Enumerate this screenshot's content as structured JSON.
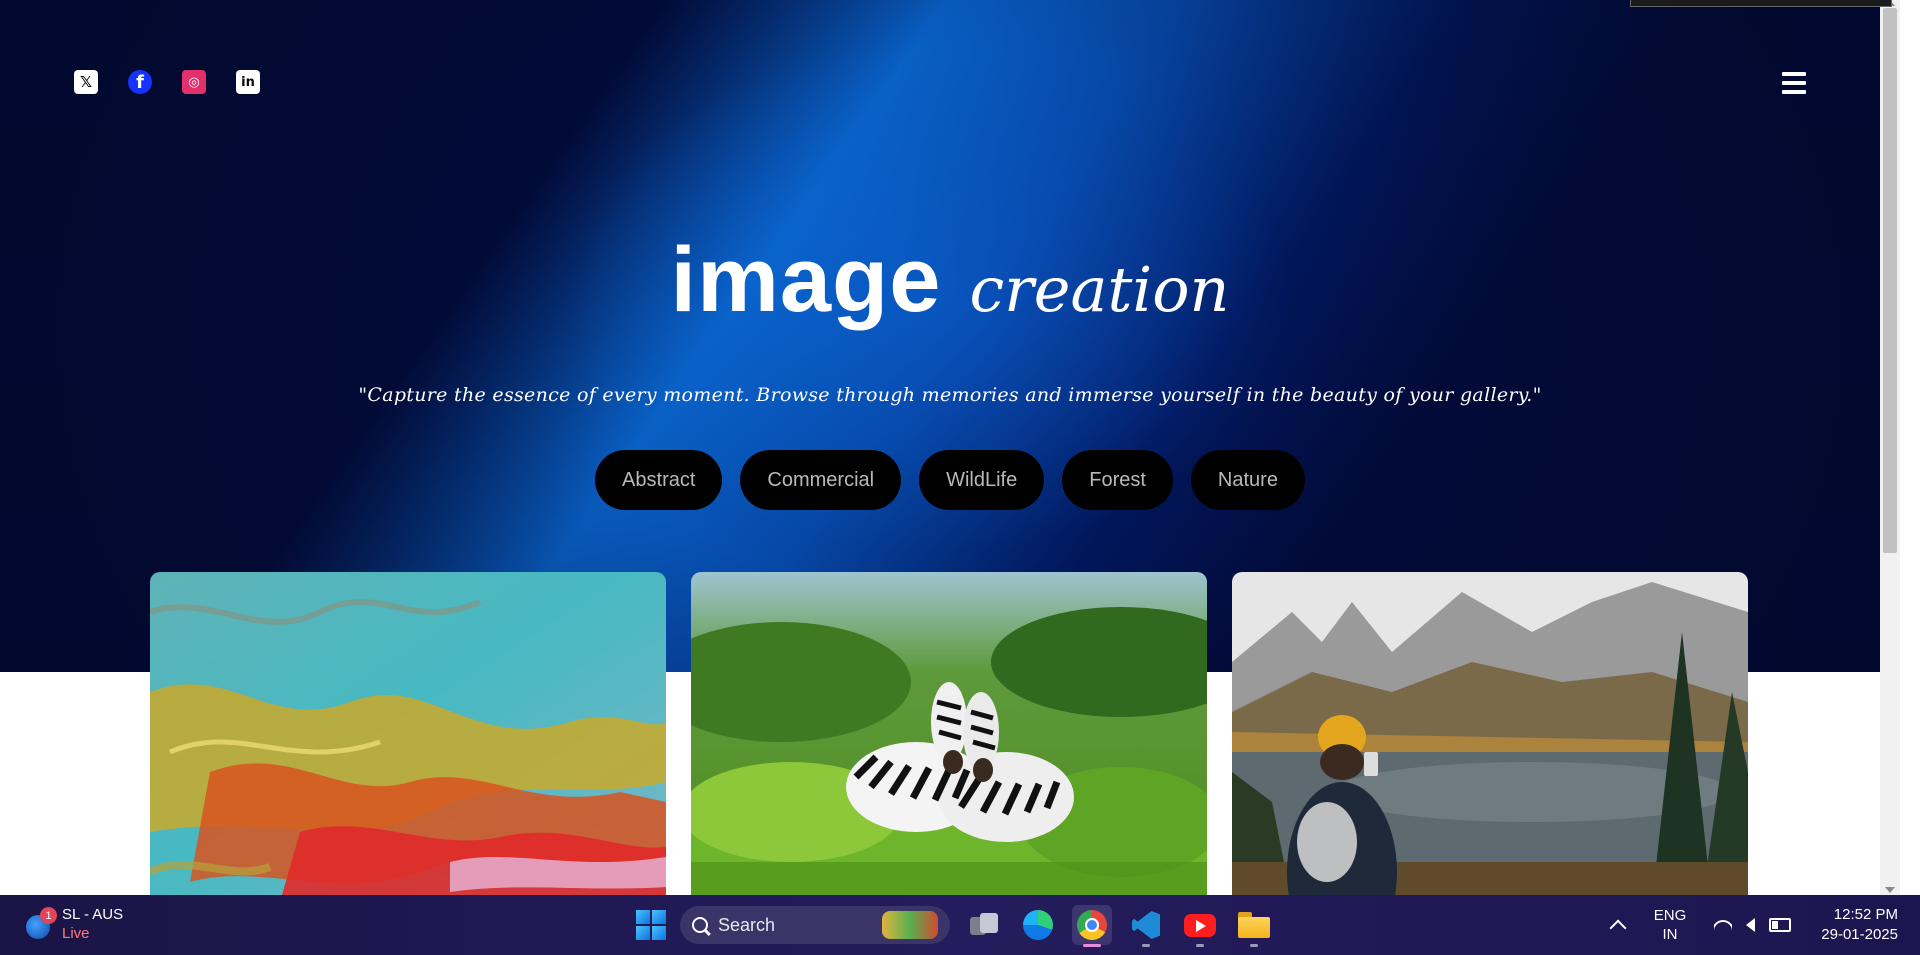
{
  "hero": {
    "title_main": "image",
    "title_script": "creation",
    "quote": "\"Capture the essence of every moment. Browse through memories and immerse yourself in the beauty of your gallery.\"",
    "categories": [
      "Abstract",
      "Commercial",
      "WildLife",
      "Forest",
      "Nature"
    ]
  },
  "social": {
    "x": "𝕏",
    "facebook": "f",
    "instagram": "◎",
    "linkedin": "in"
  },
  "colors": {
    "hero_bg": "#020b3a",
    "beam": "#0a6edc",
    "pill_bg": "#000000",
    "pill_text": "#b9b9b9"
  },
  "gallery": {
    "images": [
      "abstract-paint-image",
      "zebras-image",
      "mountain-lake-hiker-image"
    ]
  },
  "taskbar": {
    "widget_line1": "SL - AUS",
    "widget_line2": "Live",
    "widget_badge": "1",
    "search_label": "Search",
    "lang_line1": "ENG",
    "lang_line2": "IN",
    "time": "12:52 PM",
    "date": "29-01-2025"
  }
}
